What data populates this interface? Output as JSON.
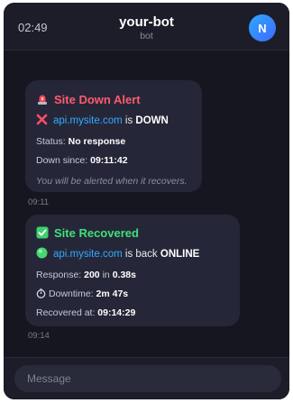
{
  "header": {
    "time": "02:49",
    "title": "your-bot",
    "subtitle": "bot",
    "avatar_letter": "N"
  },
  "messages": [
    {
      "heading": "Site Down Alert",
      "host": "api.mysite.com",
      "is_text": "is",
      "state": "DOWN",
      "status_label": "Status:",
      "status_value": "No response",
      "since_label": "Down since:",
      "since_value": "09:11:42",
      "note": "You will be alerted when it recovers.",
      "timestamp": "09:11"
    },
    {
      "heading": "Site Recovered",
      "host": "api.mysite.com",
      "is_text": "is back",
      "state": "ONLINE",
      "response_label": "Response:",
      "response_code": "200",
      "response_in": "in",
      "response_time": "0.38s",
      "downtime_label": "Downtime:",
      "downtime_value": "2m 47s",
      "recovered_label": "Recovered at:",
      "recovered_value": "09:14:29",
      "timestamp": "09:14"
    }
  ],
  "composer": {
    "placeholder": "Message"
  },
  "icons": {
    "alert": "siren-icon",
    "down": "cross-mark-icon",
    "recovered": "check-box-icon",
    "online": "green-circle-icon",
    "downtime": "stopwatch-icon"
  }
}
